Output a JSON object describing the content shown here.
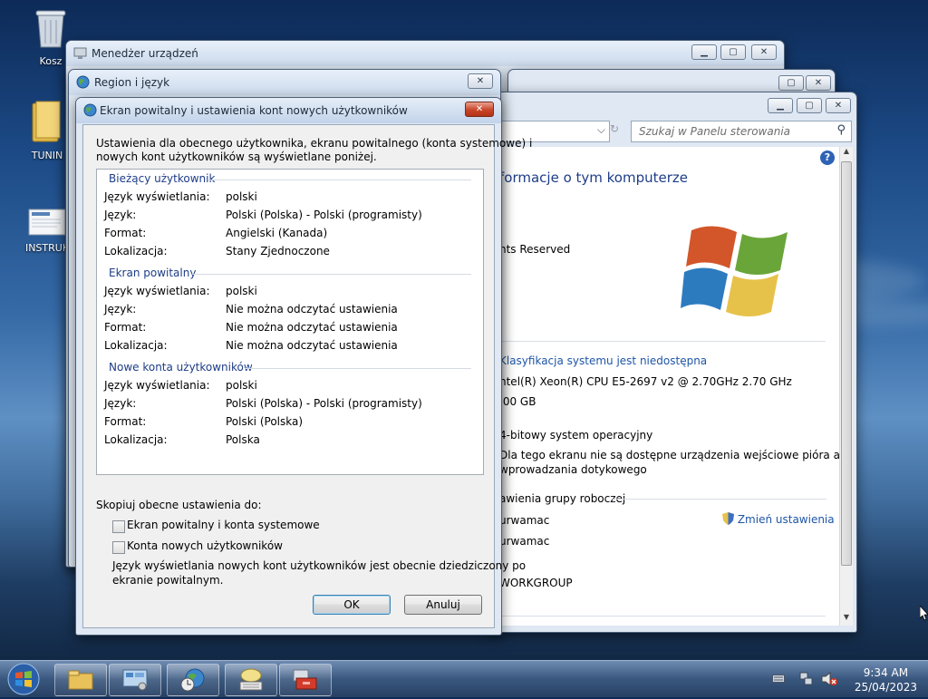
{
  "desktop": {
    "icons": [
      {
        "label": "Kosz"
      },
      {
        "label": "TUNIN"
      },
      {
        "label": "INSTRUK"
      }
    ]
  },
  "device_manager": {
    "title": "Menedżer urządzeń"
  },
  "region_window": {
    "title": "Region i język"
  },
  "system_window": {
    "search_placeholder": "Szukaj w Panelu sterowania",
    "heading": "formacje o tym komputerze",
    "rights": "nts Reserved",
    "rating_link": "Klasyfikacja systemu jest niedostępna",
    "cpu": "ntel(R) Xeon(R) CPU E5-2697 v2 @ 2.70GHz   2.70 GHz",
    "ram": ".00 GB",
    "system_type": "4-bitowy system operacyjny",
    "pen_line1": "Dla tego ekranu nie są dostępne urządzenia wejściowe pióra ani",
    "pen_line2": "wprowadzania dotykowego",
    "workgroup_section": "awienia grupy roboczej",
    "computer_name": "urwamac",
    "full_name": "urwamac",
    "workgroup": "WORKGROUP",
    "change_settings": "Zmień ustawienia"
  },
  "dialog": {
    "title": "Ekran powitalny i ustawienia kont nowych użytkowników",
    "intro_line1": "Ustawienia dla obecnego użytkownika, ekranu powitalnego (konta systemowe) i",
    "intro_line2": "nowych kont użytkowników są wyświetlane poniżej.",
    "sections": [
      {
        "heading": "Bieżący użytkownik",
        "rows": [
          {
            "label": "Język wyświetlania:",
            "value": "polski"
          },
          {
            "label": "Język:",
            "value": "Polski (Polska) - Polski (programisty)"
          },
          {
            "label": "Format:",
            "value": "Angielski (Kanada)"
          },
          {
            "label": "Lokalizacja:",
            "value": "Stany Zjednoczone"
          }
        ]
      },
      {
        "heading": "Ekran powitalny",
        "rows": [
          {
            "label": "Język wyświetlania:",
            "value": "polski"
          },
          {
            "label": "Język:",
            "value": "Nie można odczytać ustawienia"
          },
          {
            "label": "Format:",
            "value": "Nie można odczytać ustawienia"
          },
          {
            "label": "Lokalizacja:",
            "value": "Nie można odczytać ustawienia"
          }
        ]
      },
      {
        "heading": "Nowe konta użytkowników",
        "rows": [
          {
            "label": "Język wyświetlania:",
            "value": "polski"
          },
          {
            "label": "Język:",
            "value": "Polski (Polska) - Polski (programisty)"
          },
          {
            "label": "Format:",
            "value": "Polski (Polska)"
          },
          {
            "label": "Lokalizacja:",
            "value": "Polska"
          }
        ]
      }
    ],
    "copy_label": "Skopiuj obecne ustawienia do:",
    "checkbox1": "Ekran powitalny i konta systemowe",
    "checkbox2": "Konta nowych użytkowników",
    "note_line1": "Język wyświetlania nowych kont użytkowników jest obecnie dziedziczony po",
    "note_line2": "ekranie powitalnym.",
    "ok": "OK",
    "cancel": "Anuluj"
  },
  "taskbar": {
    "time": "9:34 AM",
    "date": "25/04/2023"
  }
}
